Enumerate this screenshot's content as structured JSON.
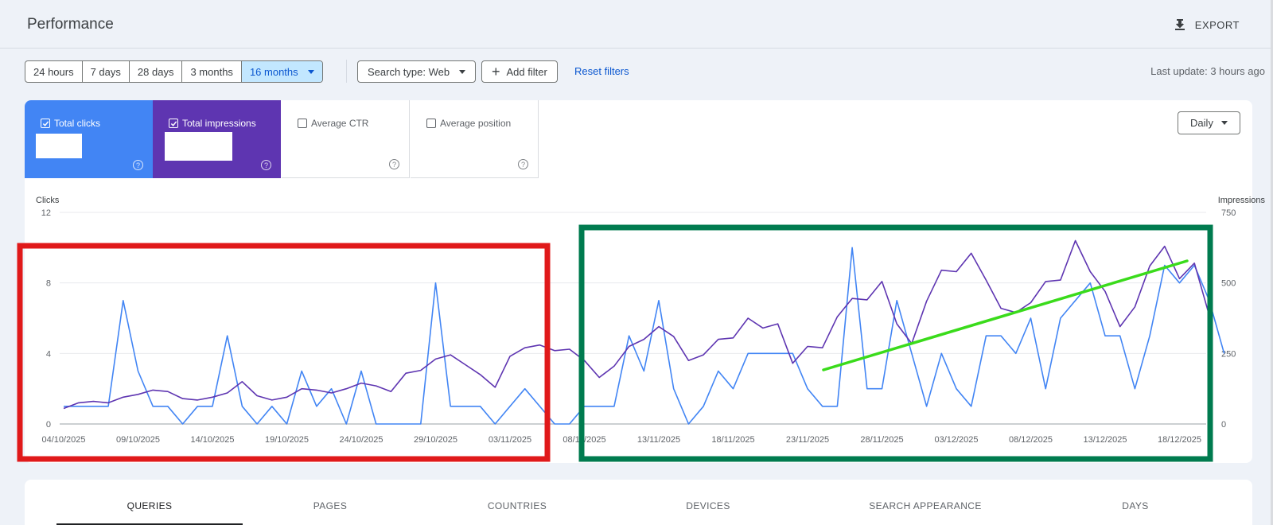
{
  "header": {
    "title": "Performance",
    "export_label": "EXPORT"
  },
  "filters": {
    "ranges": [
      "24 hours",
      "7 days",
      "28 days",
      "3 months",
      "16 months"
    ],
    "active_range": "16 months",
    "search_type": "Search type: Web",
    "add_filter": "Add filter",
    "reset": "Reset filters",
    "last_update": "Last update: 3 hours ago"
  },
  "metrics": {
    "clicks": {
      "label": "Total clicks",
      "checked": true
    },
    "impressions": {
      "label": "Total impressions",
      "checked": true
    },
    "ctr": {
      "label": "Average CTR",
      "checked": false
    },
    "position": {
      "label": "Average position",
      "checked": false
    }
  },
  "granularity": "Daily",
  "chart_data": {
    "type": "line",
    "left_axis": {
      "label": "Clicks",
      "ticks": [
        0,
        4,
        8,
        12
      ],
      "ylim": [
        0,
        12
      ]
    },
    "right_axis": {
      "label": "Impressions",
      "ticks": [
        0,
        250,
        500,
        750
      ],
      "ylim": [
        0,
        750
      ]
    },
    "x_ticks": [
      "04/10/2025",
      "09/10/2025",
      "14/10/2025",
      "19/10/2025",
      "24/10/2025",
      "29/10/2025",
      "03/11/2025",
      "08/11/2025",
      "13/11/2025",
      "18/11/2025",
      "23/11/2025",
      "28/11/2025",
      "03/12/2025",
      "08/12/2025",
      "13/12/2025",
      "18/12/2025"
    ],
    "x_start": "04/10/2025",
    "grid": true,
    "colors": {
      "clicks": "#4285f4",
      "impressions": "#5e35b1"
    },
    "series": [
      {
        "axis": "left",
        "values": [
          1,
          1,
          1,
          1,
          7,
          3,
          1,
          1,
          0,
          1,
          1,
          5,
          1,
          0,
          1,
          0,
          3,
          1,
          2,
          0,
          3,
          0,
          0,
          0,
          0,
          8,
          1,
          1,
          1,
          0,
          1,
          2,
          1,
          0,
          0,
          1,
          1,
          1,
          5,
          3,
          7,
          2,
          0,
          1,
          3,
          2,
          4,
          4,
          4,
          4,
          2,
          1,
          1,
          10,
          2,
          2,
          7,
          4,
          1,
          4,
          2,
          1,
          5,
          5,
          4,
          6,
          2,
          6,
          7,
          8,
          5,
          5,
          2,
          5,
          9,
          8,
          9,
          7,
          4
        ]
      },
      {
        "axis": "right",
        "values": [
          55,
          75,
          80,
          75,
          95,
          105,
          120,
          115,
          90,
          85,
          95,
          110,
          150,
          100,
          85,
          95,
          125,
          120,
          110,
          125,
          145,
          135,
          115,
          180,
          190,
          230,
          245,
          210,
          175,
          130,
          240,
          270,
          280,
          260,
          265,
          225,
          165,
          205,
          275,
          300,
          345,
          310,
          225,
          245,
          300,
          305,
          375,
          340,
          355,
          215,
          275,
          270,
          380,
          445,
          440,
          505,
          355,
          285,
          435,
          545,
          540,
          605,
          510,
          410,
          395,
          430,
          505,
          510,
          650,
          540,
          470,
          345,
          415,
          560,
          630,
          515,
          570,
          385
        ]
      }
    ],
    "annotations": [
      {
        "type": "rectangle",
        "color": "#e0191a"
      },
      {
        "type": "rectangle",
        "color": "#007b4f"
      },
      {
        "type": "trend-line",
        "color": "#3adb1b"
      }
    ]
  },
  "tabs": [
    "QUERIES",
    "PAGES",
    "COUNTRIES",
    "DEVICES",
    "SEARCH APPEARANCE",
    "DAYS"
  ],
  "active_tab": "QUERIES"
}
